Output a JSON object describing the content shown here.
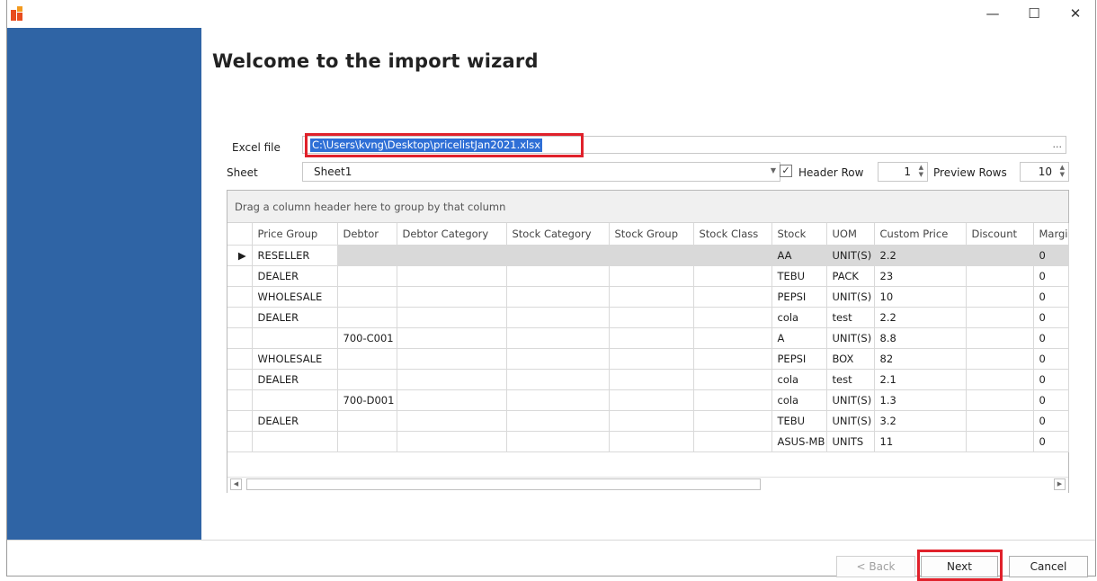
{
  "window": {
    "controls": {
      "minimize": "—",
      "maximize": "☐",
      "close": "✕"
    }
  },
  "page": {
    "title": "Welcome to the import wizard"
  },
  "form": {
    "excel_file_label": "Excel file",
    "excel_file_value": "C:\\Users\\kvng\\Desktop\\pricelistJan2021.xlsx",
    "browse_label": "...",
    "sheet_label": "Sheet",
    "sheet_value": "Sheet1",
    "header_row_label": "Header Row",
    "header_row_checked": true,
    "header_row_value": "1",
    "preview_rows_label": "Preview Rows",
    "preview_rows_value": "10"
  },
  "grid": {
    "group_panel_text": "Drag a column header here to group by that column",
    "columns": [
      "Price Group",
      "Debtor",
      "Debtor Category",
      "Stock Category",
      "Stock Group",
      "Stock Class",
      "Stock",
      "UOM",
      "Custom Price",
      "Discount",
      "Margi"
    ],
    "rows": [
      [
        "RESELLER",
        "",
        "",
        "",
        "",
        "",
        "AA",
        "UNIT(S)",
        "2.2",
        "",
        "0"
      ],
      [
        "DEALER",
        "",
        "",
        "",
        "",
        "",
        "TEBU",
        "PACK",
        "23",
        "",
        "0"
      ],
      [
        "WHOLESALE",
        "",
        "",
        "",
        "",
        "",
        "PEPSI",
        "UNIT(S)",
        "10",
        "",
        "0"
      ],
      [
        "DEALER",
        "",
        "",
        "",
        "",
        "",
        "cola",
        "test",
        "2.2",
        "",
        "0"
      ],
      [
        "",
        "700-C001",
        "",
        "",
        "",
        "",
        "A",
        "UNIT(S)",
        "8.8",
        "",
        "0"
      ],
      [
        "WHOLESALE",
        "",
        "",
        "",
        "",
        "",
        "PEPSI",
        "BOX",
        "82",
        "",
        "0"
      ],
      [
        "DEALER",
        "",
        "",
        "",
        "",
        "",
        "cola",
        "test",
        "2.1",
        "",
        "0"
      ],
      [
        "",
        "700-D001",
        "",
        "",
        "",
        "",
        "cola",
        "UNIT(S)",
        "1.3",
        "",
        "0"
      ],
      [
        "DEALER",
        "",
        "",
        "",
        "",
        "",
        "TEBU",
        "UNIT(S)",
        "3.2",
        "",
        "0"
      ],
      [
        "",
        "",
        "",
        "",
        "",
        "",
        "ASUS-MB",
        "UNITS",
        "11",
        "",
        "0"
      ]
    ]
  },
  "buttons": {
    "back": "< Back",
    "next": "Next",
    "cancel": "Cancel"
  },
  "colors": {
    "sidebar": "#2f64a5",
    "highlight": "#e0212b",
    "selection": "#2f6fd6"
  }
}
